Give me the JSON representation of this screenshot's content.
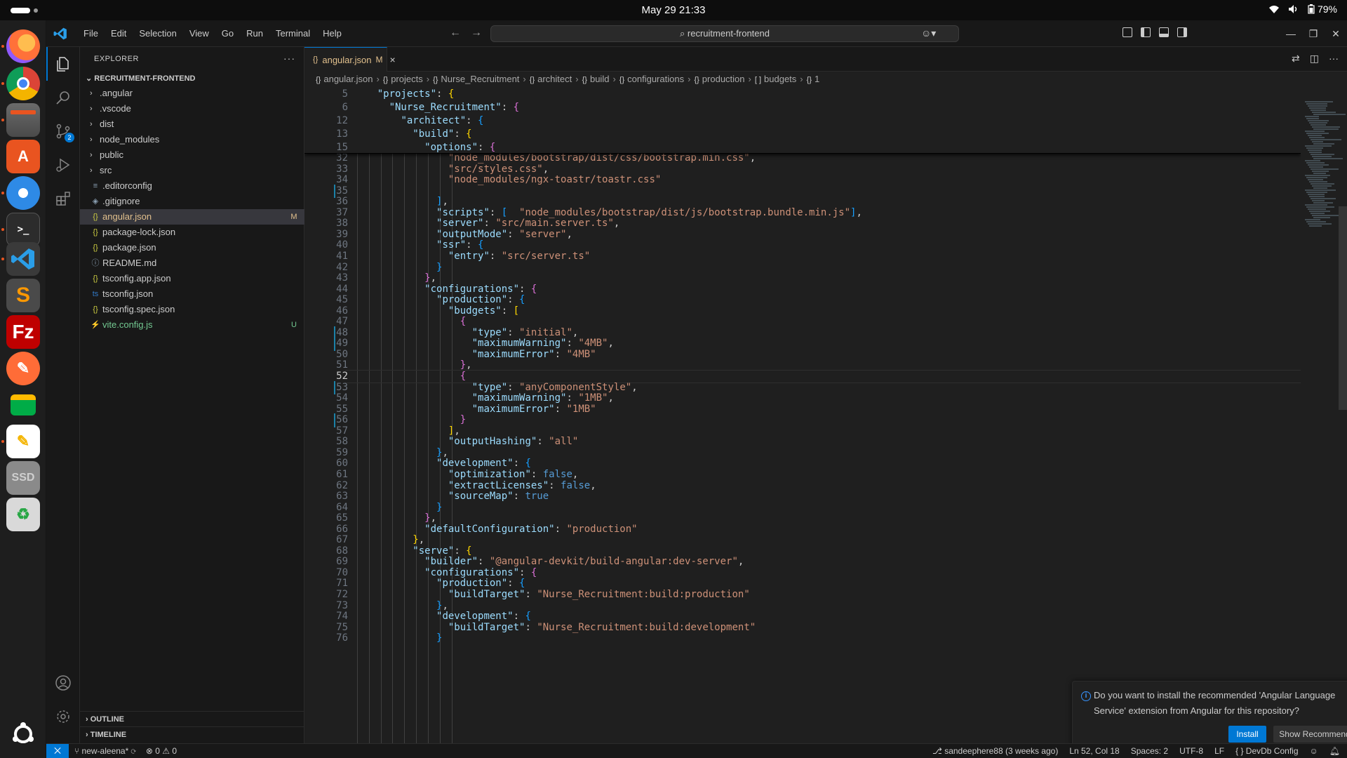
{
  "system": {
    "clock": "May 29  21:33",
    "battery": "79%"
  },
  "dock": {
    "apps": [
      "firefox-icon",
      "chrome-icon",
      "files-icon",
      "app-center-icon",
      "thunderbird-icon",
      "terminal-icon",
      "vscode-icon",
      "sublime-text-icon",
      "filezilla-icon",
      "postman-icon",
      "google-chat-icon",
      "text-editor-icon",
      "ssd-drive-icon",
      "trash-icon",
      "show-apps-icon"
    ],
    "labels": {
      "ssd": "SSD"
    }
  },
  "window": {
    "menu": [
      "File",
      "Edit",
      "Selection",
      "View",
      "Go",
      "Run",
      "Terminal",
      "Help"
    ],
    "search": "recruitment-frontend"
  },
  "explorer": {
    "title": "EXPLORER",
    "more": "···",
    "root": "RECRUITMENT-FRONTEND",
    "items": [
      {
        "name": ".angular",
        "type": "folder"
      },
      {
        "name": ".vscode",
        "type": "folder"
      },
      {
        "name": "dist",
        "type": "folder"
      },
      {
        "name": "node_modules",
        "type": "folder"
      },
      {
        "name": "public",
        "type": "folder"
      },
      {
        "name": "src",
        "type": "folder"
      },
      {
        "name": ".editorconfig",
        "type": "file",
        "icon": "≡"
      },
      {
        "name": ".gitignore",
        "type": "file",
        "icon": "◈"
      },
      {
        "name": "angular.json",
        "type": "file",
        "icon": "{}",
        "status": "M"
      },
      {
        "name": "package-lock.json",
        "type": "file",
        "icon": "{}"
      },
      {
        "name": "package.json",
        "type": "file",
        "icon": "{}"
      },
      {
        "name": "README.md",
        "type": "file",
        "icon": "ⓘ"
      },
      {
        "name": "tsconfig.app.json",
        "type": "file",
        "icon": "{}"
      },
      {
        "name": "tsconfig.json",
        "type": "file",
        "icon": "ts"
      },
      {
        "name": "tsconfig.spec.json",
        "type": "file",
        "icon": "{}"
      },
      {
        "name": "vite.config.js",
        "type": "file",
        "icon": "⚡",
        "status": "U"
      }
    ],
    "outline": "OUTLINE",
    "timeline": "TIMELINE"
  },
  "tab": {
    "name": "angular.json",
    "mark": "M"
  },
  "breadcrumb": [
    "angular.json",
    "projects",
    "Nurse_Recruitment",
    "architect",
    "build",
    "configurations",
    "production",
    "budgets",
    "1"
  ],
  "sticky": [
    {
      "ln": "5",
      "ind": 2,
      "t": [
        [
          "k",
          "\"projects\""
        ],
        [
          "p",
          ": "
        ],
        [
          "br1",
          "{"
        ]
      ]
    },
    {
      "ln": "6",
      "ind": 3,
      "t": [
        [
          "k",
          "\"Nurse_Recruitment\""
        ],
        [
          "p",
          ": "
        ],
        [
          "br2",
          "{"
        ]
      ]
    },
    {
      "ln": "12",
      "ind": 4,
      "t": [
        [
          "k",
          "\"architect\""
        ],
        [
          "p",
          ": "
        ],
        [
          "br3",
          "{"
        ]
      ]
    },
    {
      "ln": "13",
      "ind": 5,
      "t": [
        [
          "k",
          "\"build\""
        ],
        [
          "p",
          ": "
        ],
        [
          "br1",
          "{"
        ]
      ]
    },
    {
      "ln": "15",
      "ind": 6,
      "t": [
        [
          "k",
          "\"options\""
        ],
        [
          "p",
          ": "
        ],
        [
          "br2",
          "{"
        ]
      ]
    }
  ],
  "code": [
    {
      "ln": "32",
      "ind": 8,
      "t": [
        [
          "s",
          "\"node_modules/bootstrap/dist/css/bootstrap.min.css\""
        ],
        [
          "p",
          ","
        ]
      ]
    },
    {
      "ln": "33",
      "ind": 8,
      "t": [
        [
          "s",
          "\"src/styles.css\""
        ],
        [
          "p",
          ","
        ]
      ]
    },
    {
      "ln": "34",
      "ind": 8,
      "t": [
        [
          "s",
          "\"node_modules/ngx-toastr/toastr.css\""
        ]
      ]
    },
    {
      "ln": "35",
      "ind": 0,
      "t": []
    },
    {
      "ln": "36",
      "ind": 7,
      "t": [
        [
          "br3",
          "]"
        ],
        [
          "p",
          ","
        ]
      ]
    },
    {
      "ln": "37",
      "ind": 7,
      "t": [
        [
          "k",
          "\"scripts\""
        ],
        [
          "p",
          ": "
        ],
        [
          "br3",
          "["
        ],
        [
          "p",
          "  "
        ],
        [
          "s",
          "\"node_modules/bootstrap/dist/js/bootstrap.bundle.min.js\""
        ],
        [
          "br3",
          "]"
        ],
        [
          "p",
          ","
        ]
      ]
    },
    {
      "ln": "38",
      "ind": 7,
      "t": [
        [
          "k",
          "\"server\""
        ],
        [
          "p",
          ": "
        ],
        [
          "s",
          "\"src/main.server.ts\""
        ],
        [
          "p",
          ","
        ]
      ]
    },
    {
      "ln": "39",
      "ind": 7,
      "t": [
        [
          "k",
          "\"outputMode\""
        ],
        [
          "p",
          ": "
        ],
        [
          "s",
          "\"server\""
        ],
        [
          "p",
          ","
        ]
      ]
    },
    {
      "ln": "40",
      "ind": 7,
      "t": [
        [
          "k",
          "\"ssr\""
        ],
        [
          "p",
          ": "
        ],
        [
          "br3",
          "{"
        ]
      ]
    },
    {
      "ln": "41",
      "ind": 8,
      "t": [
        [
          "k",
          "\"entry\""
        ],
        [
          "p",
          ": "
        ],
        [
          "s",
          "\"src/server.ts\""
        ]
      ]
    },
    {
      "ln": "42",
      "ind": 7,
      "t": [
        [
          "br3",
          "}"
        ]
      ]
    },
    {
      "ln": "43",
      "ind": 6,
      "t": [
        [
          "br2",
          "}"
        ],
        [
          "p",
          ","
        ]
      ]
    },
    {
      "ln": "44",
      "ind": 6,
      "t": [
        [
          "k",
          "\"configurations\""
        ],
        [
          "p",
          ": "
        ],
        [
          "br2",
          "{"
        ]
      ]
    },
    {
      "ln": "45",
      "ind": 7,
      "t": [
        [
          "k",
          "\"production\""
        ],
        [
          "p",
          ": "
        ],
        [
          "br3",
          "{"
        ]
      ]
    },
    {
      "ln": "46",
      "ind": 8,
      "t": [
        [
          "k",
          "\"budgets\""
        ],
        [
          "p",
          ": "
        ],
        [
          "br1",
          "["
        ]
      ]
    },
    {
      "ln": "47",
      "ind": 9,
      "t": [
        [
          "br2",
          "{"
        ]
      ]
    },
    {
      "ln": "48",
      "ind": 10,
      "t": [
        [
          "k",
          "\"type\""
        ],
        [
          "p",
          ": "
        ],
        [
          "s",
          "\"initial\""
        ],
        [
          "p",
          ","
        ]
      ]
    },
    {
      "ln": "49",
      "ind": 10,
      "t": [
        [
          "k",
          "\"maximumWarning\""
        ],
        [
          "p",
          ": "
        ],
        [
          "s",
          "\"4MB\""
        ],
        [
          "p",
          ","
        ]
      ]
    },
    {
      "ln": "50",
      "ind": 10,
      "t": [
        [
          "k",
          "\"maximumError\""
        ],
        [
          "p",
          ": "
        ],
        [
          "s",
          "\"4MB\""
        ]
      ]
    },
    {
      "ln": "51",
      "ind": 9,
      "t": [
        [
          "br2",
          "}"
        ],
        [
          "p",
          ","
        ]
      ]
    },
    {
      "ln": "52",
      "ind": 9,
      "t": [
        [
          "br2",
          "{"
        ]
      ],
      "current": true
    },
    {
      "ln": "53",
      "ind": 10,
      "t": [
        [
          "k",
          "\"type\""
        ],
        [
          "p",
          ": "
        ],
        [
          "s",
          "\"anyComponentStyle\""
        ],
        [
          "p",
          ","
        ]
      ]
    },
    {
      "ln": "54",
      "ind": 10,
      "t": [
        [
          "k",
          "\"maximumWarning\""
        ],
        [
          "p",
          ": "
        ],
        [
          "s",
          "\"1MB\""
        ],
        [
          "p",
          ","
        ]
      ]
    },
    {
      "ln": "55",
      "ind": 10,
      "t": [
        [
          "k",
          "\"maximumError\""
        ],
        [
          "p",
          ": "
        ],
        [
          "s",
          "\"1MB\""
        ]
      ]
    },
    {
      "ln": "56",
      "ind": 9,
      "t": [
        [
          "br2",
          "}"
        ]
      ]
    },
    {
      "ln": "57",
      "ind": 8,
      "t": [
        [
          "br1",
          "]"
        ],
        [
          "p",
          ","
        ]
      ]
    },
    {
      "ln": "58",
      "ind": 8,
      "t": [
        [
          "k",
          "\"outputHashing\""
        ],
        [
          "p",
          ": "
        ],
        [
          "s",
          "\"all\""
        ]
      ]
    },
    {
      "ln": "59",
      "ind": 7,
      "t": [
        [
          "br3",
          "}"
        ],
        [
          "p",
          ","
        ]
      ]
    },
    {
      "ln": "60",
      "ind": 7,
      "t": [
        [
          "k",
          "\"development\""
        ],
        [
          "p",
          ": "
        ],
        [
          "br3",
          "{"
        ]
      ]
    },
    {
      "ln": "61",
      "ind": 8,
      "t": [
        [
          "k",
          "\"optimization\""
        ],
        [
          "p",
          ": "
        ],
        [
          "b",
          "false"
        ],
        [
          "p",
          ","
        ]
      ]
    },
    {
      "ln": "62",
      "ind": 8,
      "t": [
        [
          "k",
          "\"extractLicenses\""
        ],
        [
          "p",
          ": "
        ],
        [
          "b",
          "false"
        ],
        [
          "p",
          ","
        ]
      ]
    },
    {
      "ln": "63",
      "ind": 8,
      "t": [
        [
          "k",
          "\"sourceMap\""
        ],
        [
          "p",
          ": "
        ],
        [
          "b",
          "true"
        ]
      ]
    },
    {
      "ln": "64",
      "ind": 7,
      "t": [
        [
          "br3",
          "}"
        ]
      ]
    },
    {
      "ln": "65",
      "ind": 6,
      "t": [
        [
          "br2",
          "}"
        ],
        [
          "p",
          ","
        ]
      ]
    },
    {
      "ln": "66",
      "ind": 6,
      "t": [
        [
          "k",
          "\"defaultConfiguration\""
        ],
        [
          "p",
          ": "
        ],
        [
          "s",
          "\"production\""
        ]
      ]
    },
    {
      "ln": "67",
      "ind": 5,
      "t": [
        [
          "br1",
          "}"
        ],
        [
          "p",
          ","
        ]
      ]
    },
    {
      "ln": "68",
      "ind": 5,
      "t": [
        [
          "k",
          "\"serve\""
        ],
        [
          "p",
          ": "
        ],
        [
          "br1",
          "{"
        ]
      ]
    },
    {
      "ln": "69",
      "ind": 6,
      "t": [
        [
          "k",
          "\"builder\""
        ],
        [
          "p",
          ": "
        ],
        [
          "s",
          "\"@angular-devkit/build-angular:dev-server\""
        ],
        [
          "p",
          ","
        ]
      ]
    },
    {
      "ln": "70",
      "ind": 6,
      "t": [
        [
          "k",
          "\"configurations\""
        ],
        [
          "p",
          ": "
        ],
        [
          "br2",
          "{"
        ]
      ]
    },
    {
      "ln": "71",
      "ind": 7,
      "t": [
        [
          "k",
          "\"production\""
        ],
        [
          "p",
          ": "
        ],
        [
          "br3",
          "{"
        ]
      ]
    },
    {
      "ln": "72",
      "ind": 8,
      "t": [
        [
          "k",
          "\"buildTarget\""
        ],
        [
          "p",
          ": "
        ],
        [
          "s",
          "\"Nurse_Recruitment:build:production\""
        ]
      ]
    },
    {
      "ln": "73",
      "ind": 7,
      "t": [
        [
          "br3",
          "}"
        ],
        [
          "p",
          ","
        ]
      ]
    },
    {
      "ln": "74",
      "ind": 7,
      "t": [
        [
          "k",
          "\"development\""
        ],
        [
          "p",
          ": "
        ],
        [
          "br3",
          "{"
        ]
      ]
    },
    {
      "ln": "75",
      "ind": 8,
      "t": [
        [
          "k",
          "\"buildTarget\""
        ],
        [
          "p",
          ": "
        ],
        [
          "s",
          "\"Nurse_Recruitment:build:development\""
        ]
      ]
    },
    {
      "ln": "76",
      "ind": 7,
      "t": [
        [
          "br3",
          "}"
        ]
      ]
    }
  ],
  "notification": {
    "text": "Do you want to install the recommended 'Angular Language Service' extension from Angular for this repository?",
    "install": "Install",
    "show": "Show Recommendations"
  },
  "status": {
    "branch": "new-aleena*",
    "problems": "0",
    "warnings": "0",
    "blame": "sandeephere88 (3 weeks ago)",
    "position": "Ln 52, Col 18",
    "spaces": "Spaces: 2",
    "encoding": "UTF-8",
    "eol": "LF",
    "language": "{ } DevDb Config"
  },
  "colors": {
    "accent": "#0078d4",
    "modified": "#e2c08d",
    "untracked": "#73c991"
  }
}
